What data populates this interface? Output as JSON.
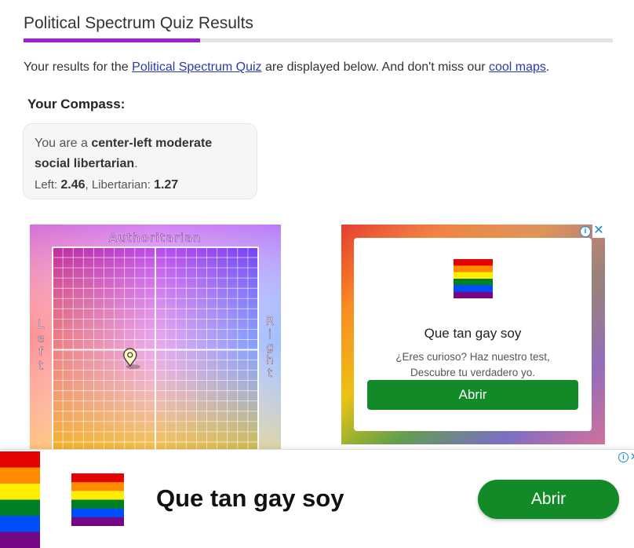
{
  "page": {
    "title": "Political Spectrum Quiz Results",
    "title_progress_percent": 30
  },
  "intro": {
    "prefix": "Your results for the ",
    "quiz_link": "Political Spectrum Quiz",
    "middle": " are displayed below. And don't miss our ",
    "maps_link": "cool maps",
    "suffix": "."
  },
  "compass_section": {
    "heading": "Your Compass:",
    "result_prefix": "You are a ",
    "result_bold_1": "center-left moderate",
    "result_bold_2": "social libertarian",
    "result_suffix": ".",
    "left_label": "Left: ",
    "left_value": "2.46",
    "separator": ", ",
    "libertarian_label": "Libertarian: ",
    "libertarian_value": "1.27"
  },
  "compass_chart": {
    "top_label": "Authoritarian",
    "left_label": "Left",
    "right_label": "Right",
    "position_left": 2.46,
    "position_libertarian": 1.27,
    "marker_icon": "map-pin-icon"
  },
  "ad_top": {
    "title": "Que tan gay soy",
    "desc_line1": "¿Eres curioso? Haz nuestro test,",
    "desc_line2": "Descubre tu verdadero yo.",
    "button": "Abrir",
    "info_glyph": "i",
    "close_glyph": "✕"
  },
  "ad_bottom": {
    "title": "Que tan gay soy",
    "button": "Abrir",
    "info_glyph": "i",
    "close_glyph": "✕"
  },
  "colors": {
    "accent_purple": "#9b1fd6",
    "button_green": "#128a27",
    "link_blue": "#2a3aa8",
    "ad_info_blue": "#1a8ad4",
    "rainbow": [
      "#e40303",
      "#ff8c00",
      "#ffed00",
      "#008026",
      "#004dff",
      "#750787"
    ]
  }
}
